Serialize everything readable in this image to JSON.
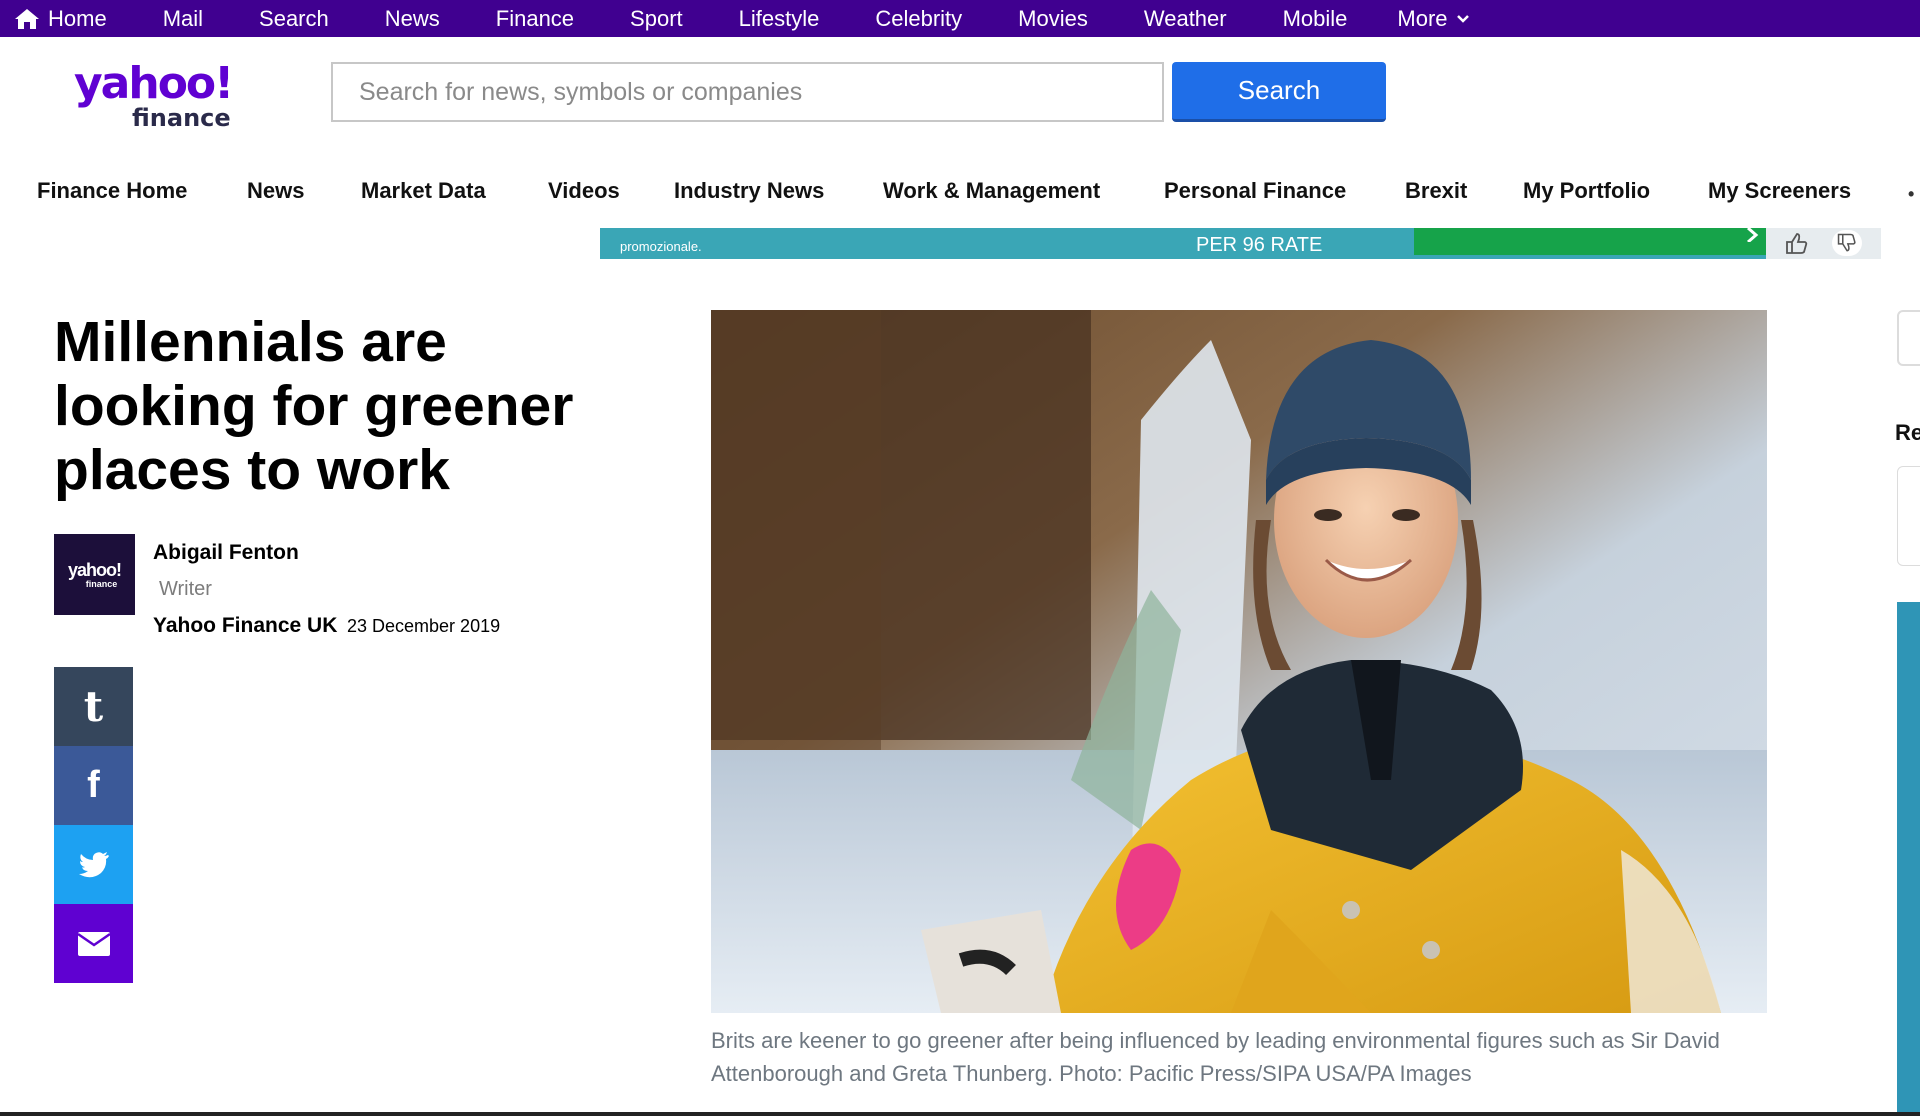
{
  "topnav": {
    "items": [
      "Home",
      "Mail",
      "Search",
      "News",
      "Finance",
      "Sport",
      "Lifestyle",
      "Celebrity",
      "Movies",
      "Weather",
      "Mobile",
      "More"
    ]
  },
  "header": {
    "logo_main": "yahoo!",
    "logo_sub": "finance",
    "search_placeholder": "Search for news, symbols or companies",
    "search_button": "Search"
  },
  "subnav": {
    "items": [
      "Finance Home",
      "News",
      "Market Data",
      "Videos",
      "Industry News",
      "Work & Management",
      "Personal Finance",
      "Brexit",
      "My Portfolio",
      "My Screeners"
    ]
  },
  "ad": {
    "text1": "promozionale.",
    "text3": "PER 96 RATE"
  },
  "article": {
    "headline": "Millennials are looking for greener places to work",
    "author_name": "Abigail Fenton",
    "author_role": "Writer",
    "author_logo_main": "yahoo!",
    "author_logo_sub": "finance",
    "publisher": "Yahoo Finance UK",
    "date": "23 December 2019",
    "caption": "Brits are keener to go greener after being influenced by leading environmental figures such as Sir David Attenborough and Greta Thunberg. Photo: Pacific Press/SIPA USA/PA Images"
  },
  "share": {
    "tumblr_glyph": "t",
    "facebook_glyph": "f"
  },
  "sidebar": {
    "partial_label": "Re"
  },
  "colors": {
    "topbar": "#400090",
    "brand": "#6001d2",
    "search_button": "#1f6ee8",
    "tumblr": "#35465c",
    "facebook": "#3b5998",
    "twitter": "#1da1f2",
    "email": "#5f01d1"
  }
}
